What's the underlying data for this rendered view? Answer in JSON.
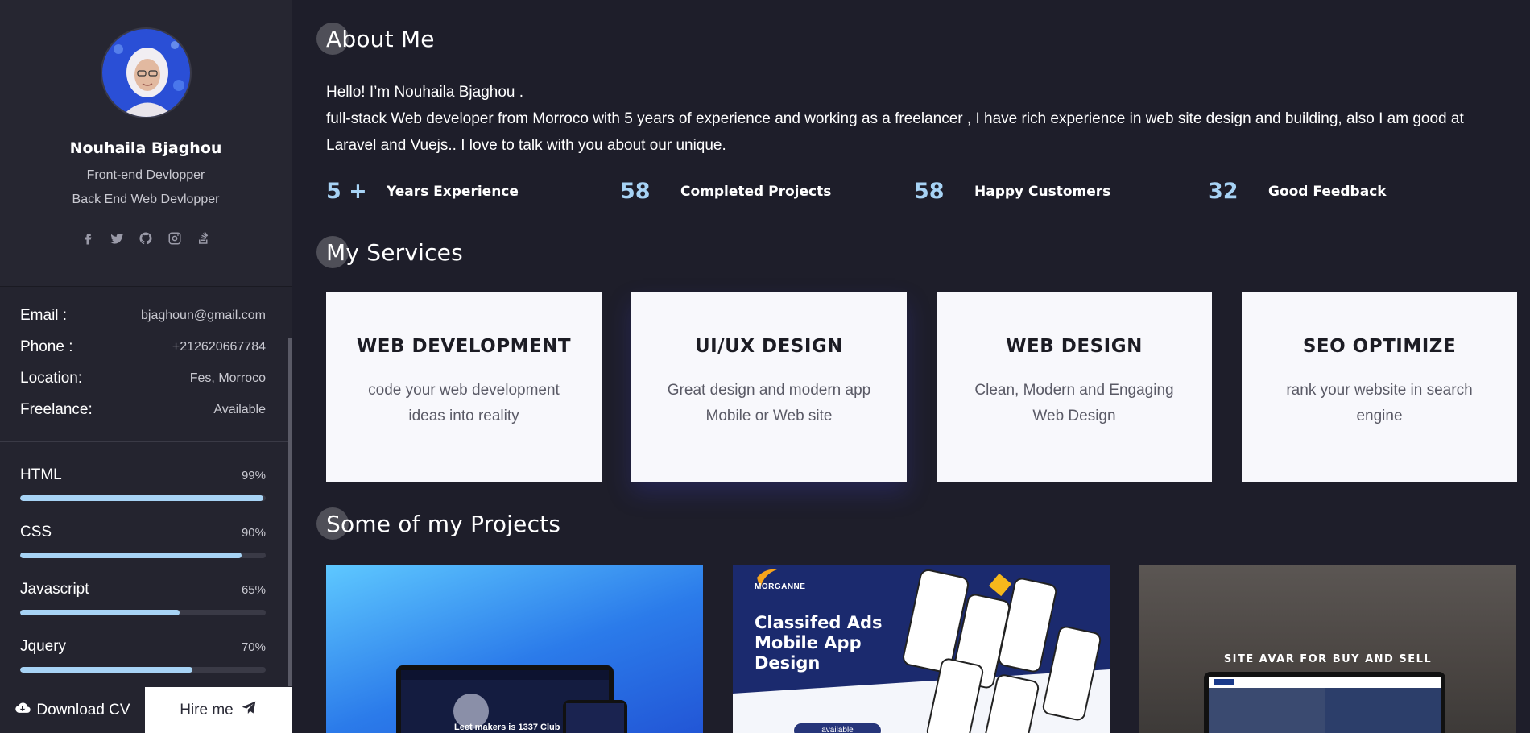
{
  "profile": {
    "name": "Nouhaila Bjaghou",
    "roles": [
      "Front-end Devlopper",
      "Back End Web Devlopper"
    ],
    "socials": [
      "facebook-icon",
      "twitter-icon",
      "github-icon",
      "instagram-icon",
      "stackoverflow-icon"
    ]
  },
  "info": [
    {
      "label": "Email :",
      "value": "bjaghoun@gmail.com"
    },
    {
      "label": "Phone :",
      "value": "+212620667784"
    },
    {
      "label": "Location:",
      "value": "Fes, Morroco"
    },
    {
      "label": "Freelance:",
      "value": "Available"
    }
  ],
  "skills": [
    {
      "name": "HTML",
      "percent_label": "99%",
      "level": 0.99
    },
    {
      "name": "CSS",
      "percent_label": "90%",
      "level": 0.9
    },
    {
      "name": "Javascript",
      "percent_label": "65%",
      "level": 0.65
    },
    {
      "name": "Jquery",
      "percent_label": "70%",
      "level": 0.7
    }
  ],
  "buttons": {
    "download": "Download CV",
    "download_icon": "cloud-download-icon",
    "hire": "Hire me",
    "hire_icon": "paper-plane-icon"
  },
  "about": {
    "title": "About Me",
    "greeting": "Hello! I’m Nouhaila Bjaghou .",
    "body": "full-stack Web developer from Morroco with 5 years of experience and working as a freelancer , I have rich experience in web site design and building, also I am good at Laravel and Vuejs.. I love to talk with you about our unique."
  },
  "stats": [
    {
      "value": "5 +",
      "label": "Years Experience"
    },
    {
      "value": "58",
      "label": "Completed Projects"
    },
    {
      "value": "58",
      "label": "Happy Customers"
    },
    {
      "value": "32",
      "label": "Good Feedback"
    }
  ],
  "services": {
    "title": "My Services",
    "items": [
      {
        "title": "WEB DEVELOPMENT",
        "desc": "code your web development ideas into reality"
      },
      {
        "title": "UI/UX DESIGN",
        "desc": "Great design and modern app Mobile or Web site"
      },
      {
        "title": "WEB DESIGN",
        "desc": "Clean, Modern and Engaging Web Design"
      },
      {
        "title": "SEO OPTIMIZE",
        "desc": "rank your website in search engine"
      }
    ]
  },
  "projects": {
    "title": "Some of my Projects",
    "p1_caption": "Leet makers is 1337 Club",
    "p2_brand": "MORGANNE",
    "p2_title": "Classifed Ads Mobile App Design",
    "p2_badge": "available",
    "p3_title": "SITE AVAR FOR BUY AND SELL"
  },
  "colors": {
    "accent": "#a7d3f5",
    "background": "#1e1e2a",
    "sidebar": "#24242f",
    "card": "#f8f8fc"
  }
}
